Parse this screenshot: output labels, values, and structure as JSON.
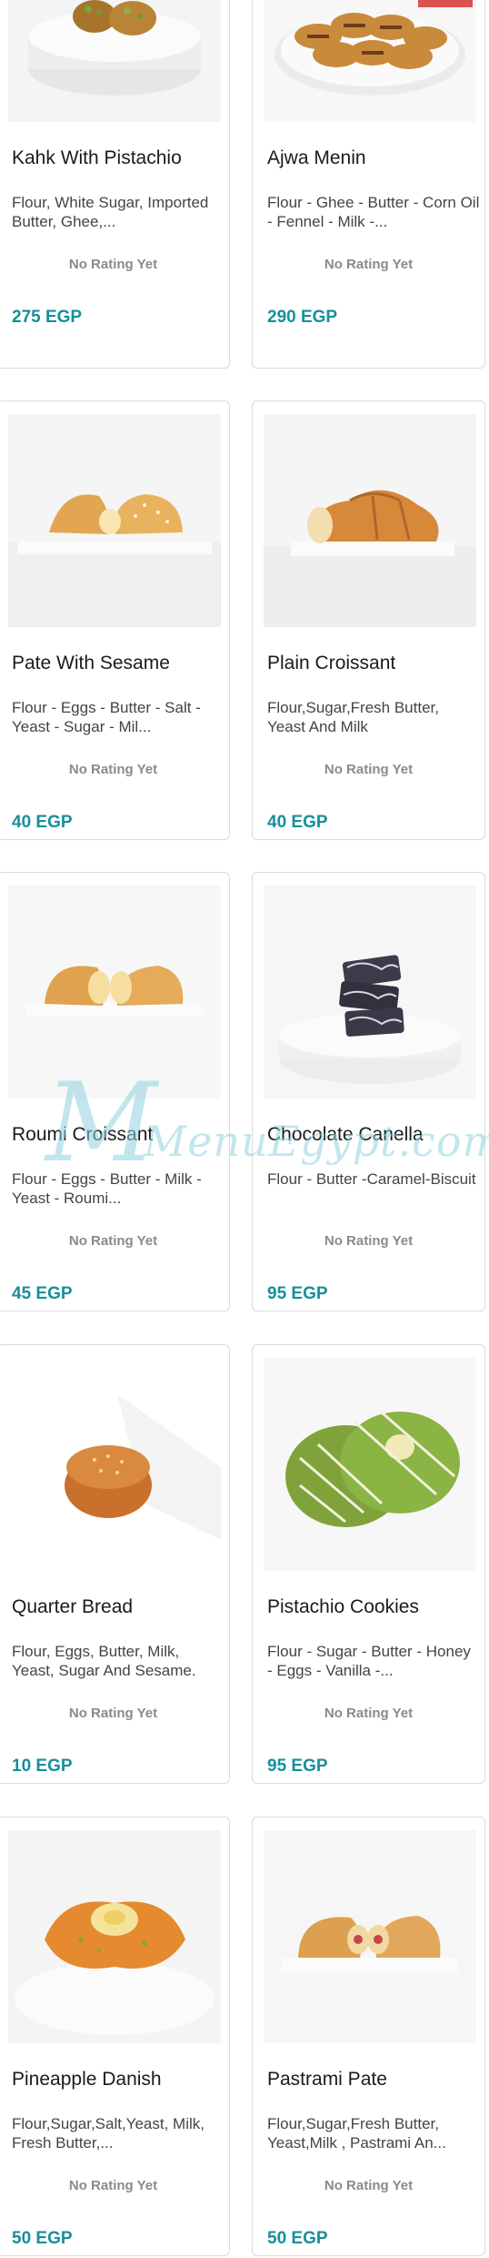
{
  "products": [
    {
      "name": "Kahk With Pistachio",
      "desc": "Flour, White Sugar, Imported Butter, Ghee,...",
      "rating": "No Rating Yet",
      "price": "275 EGP",
      "image": "kahk-pistachio-image"
    },
    {
      "name": "Ajwa Menin",
      "desc": "Flour - Ghee - Butter - Corn Oil - Fennel - Milk -...",
      "rating": "No Rating Yet",
      "price": "290 EGP",
      "image": "ajwa-menin-image"
    },
    {
      "name": "Pate With Sesame",
      "desc": "Flour - Eggs - Butter - Salt - Yeast - Sugar - Mil...",
      "rating": "No Rating Yet",
      "price": "40 EGP",
      "image": "pate-sesame-image"
    },
    {
      "name": "Plain Croissant",
      "desc": "Flour,Sugar,Fresh Butter, Yeast And Milk",
      "rating": "No Rating Yet",
      "price": "40 EGP",
      "image": "plain-croissant-image"
    },
    {
      "name": "Roumi Croissant",
      "desc": "Flour - Eggs - Butter - Milk - Yeast - Roumi...",
      "rating": "No Rating Yet",
      "price": "45 EGP",
      "image": "roumi-croissant-image"
    },
    {
      "name": "Chocolate Canella",
      "desc": "Flour - Butter -Caramel-Biscuit",
      "rating": "No Rating Yet",
      "price": "95 EGP",
      "image": "chocolate-canella-image"
    },
    {
      "name": "Quarter Bread",
      "desc": "Flour, Eggs, Butter, Milk, Yeast, Sugar And Sesame.",
      "rating": "No Rating Yet",
      "price": "10 EGP",
      "image": "quarter-bread-image"
    },
    {
      "name": "Pistachio Cookies",
      "desc": "Flour - Sugar - Butter - Honey - Eggs - Vanilla -...",
      "rating": "No Rating Yet",
      "price": "95 EGP",
      "image": "pistachio-cookies-image"
    },
    {
      "name": "Pineapple Danish",
      "desc": "Flour,Sugar,Salt,Yeast, Milk, Fresh Butter,...",
      "rating": "No Rating Yet",
      "price": "50 EGP",
      "image": "pineapple-danish-image"
    },
    {
      "name": "Pastrami Pate",
      "desc": "Flour,Sugar,Fresh Butter, Yeast,Milk , Pastrami An...",
      "rating": "No Rating Yet",
      "price": "50 EGP",
      "image": "pastrami-pate-image"
    }
  ],
  "watermark": {
    "text": "MenuEgypt.com"
  },
  "colors": {
    "price": "#178f9a",
    "rating": "#8a8a8a",
    "border": "#dadada"
  }
}
